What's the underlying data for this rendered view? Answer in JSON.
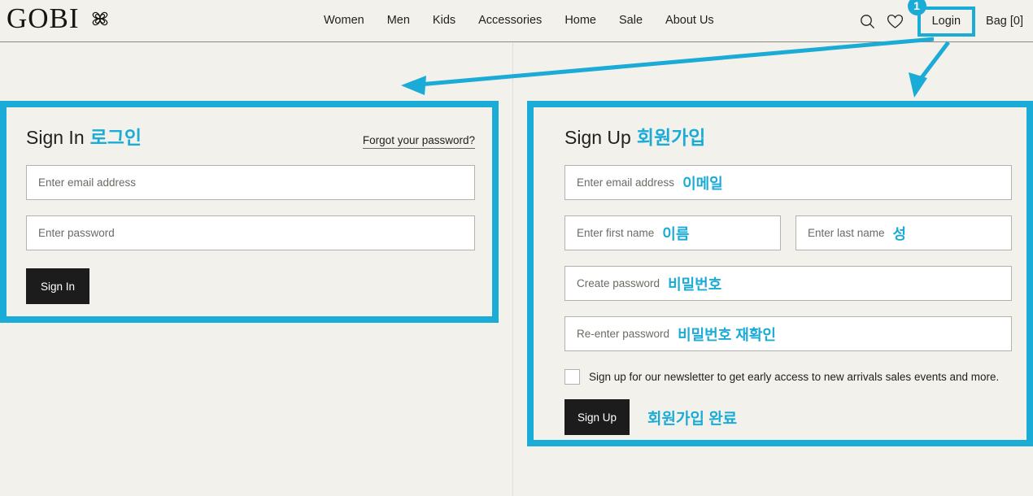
{
  "colors": {
    "accent": "#1aabd6",
    "page_bg": "#f2f1ec",
    "button_dark": "#1c1c1c",
    "text": "#23211f",
    "placeholder": "#6d6a64"
  },
  "header": {
    "brand": "GOBI",
    "brand_mark_icon": "clover-knot-icon",
    "nav": [
      {
        "label": "Women"
      },
      {
        "label": "Men"
      },
      {
        "label": "Kids"
      },
      {
        "label": "Accessories"
      },
      {
        "label": "Home"
      },
      {
        "label": "Sale"
      },
      {
        "label": "About Us"
      }
    ],
    "search_icon": "search-icon",
    "wishlist_icon": "heart-icon",
    "login_label": "Login",
    "login_step_badge": "1",
    "bag_label": "Bag [0]"
  },
  "signin": {
    "title": "Sign In",
    "title_kr": "로그인",
    "forgot_link": "Forgot your password?",
    "email_placeholder": "Enter email address",
    "password_placeholder": "Enter password",
    "submit_label": "Sign In"
  },
  "signup": {
    "title": "Sign Up",
    "title_kr": "회원가입",
    "email_placeholder": "Enter email address",
    "email_kr": "이메일",
    "first_name_placeholder": "Enter first name",
    "first_name_kr": "이름",
    "last_name_placeholder": "Enter last name",
    "last_name_kr": "성",
    "create_password_placeholder": "Create password",
    "create_password_kr": "비밀번호",
    "reenter_password_placeholder": "Re-enter password",
    "reenter_password_kr": "비밀번호 재확인",
    "newsletter_label": "Sign up for our newsletter to get early access to new arrivals sales events and more.",
    "newsletter_checked": false,
    "submit_label": "Sign Up",
    "submit_kr": "회원가입 완료"
  },
  "annotations": {
    "arrow_to_signin": "arrow-login-to-signin",
    "arrow_to_signup": "arrow-login-to-signup"
  }
}
